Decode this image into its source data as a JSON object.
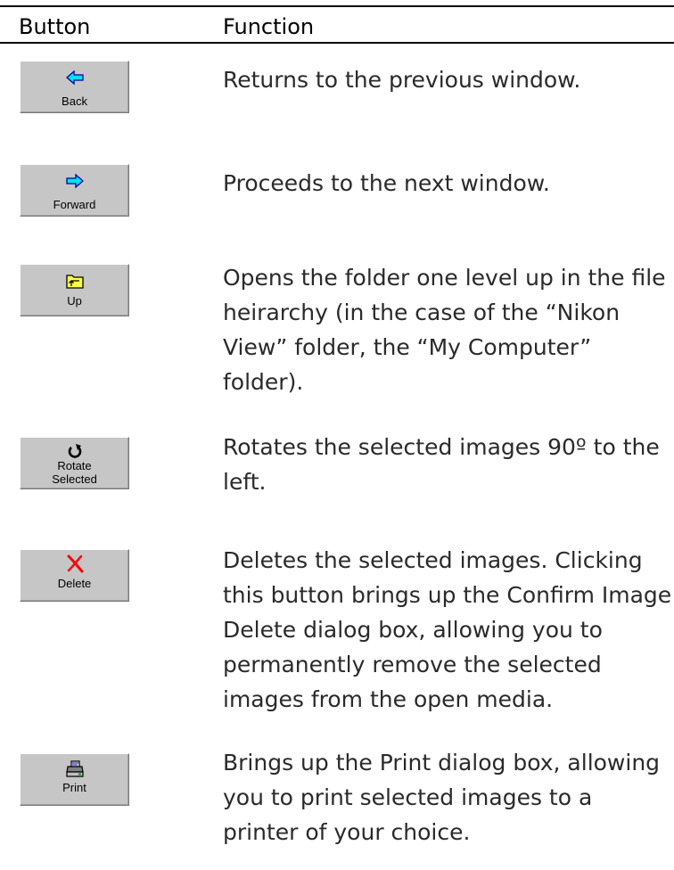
{
  "table": {
    "headers": {
      "button": "Button",
      "function": "Function"
    },
    "rows": [
      {
        "button_label_lines": [
          "Back"
        ],
        "icon": "back-arrow-icon",
        "description": "Returns to the previous window."
      },
      {
        "button_label_lines": [
          "Forward"
        ],
        "icon": "forward-arrow-icon",
        "description": "Proceeds to the next window."
      },
      {
        "button_label_lines": [
          "Up"
        ],
        "icon": "folder-up-icon",
        "description_lines": [
          "Opens the folder one level up in the file",
          "heirarchy (in the case of the “Nikon",
          "View” folder, the “My Computer”",
          "folder)."
        ]
      },
      {
        "button_label_lines": [
          "Rotate",
          "Selected"
        ],
        "icon": "rotate-icon",
        "description_lines": [
          "Rotates the selected images 90º to the",
          "left."
        ]
      },
      {
        "button_label_lines": [
          "Delete"
        ],
        "icon": "delete-x-icon",
        "description_lines": [
          "Deletes the selected images.  Clicking",
          "this button brings up the Confirm Image",
          "Delete dialog box, allowing you to",
          "permanently remove the selected",
          "images from the open media."
        ]
      },
      {
        "button_label_lines": [
          "Print"
        ],
        "icon": "printer-icon",
        "description_lines": [
          "Brings up the Print dialog box, allowing",
          "you to print selected images to a",
          "printer of your choice."
        ]
      }
    ]
  },
  "colors": {
    "arrow": "#00e0f0",
    "arrow_outline": "#0000a0",
    "folder": "#ffff40",
    "delete_x": "#ff0000",
    "button_face": "#c6c6c6"
  }
}
